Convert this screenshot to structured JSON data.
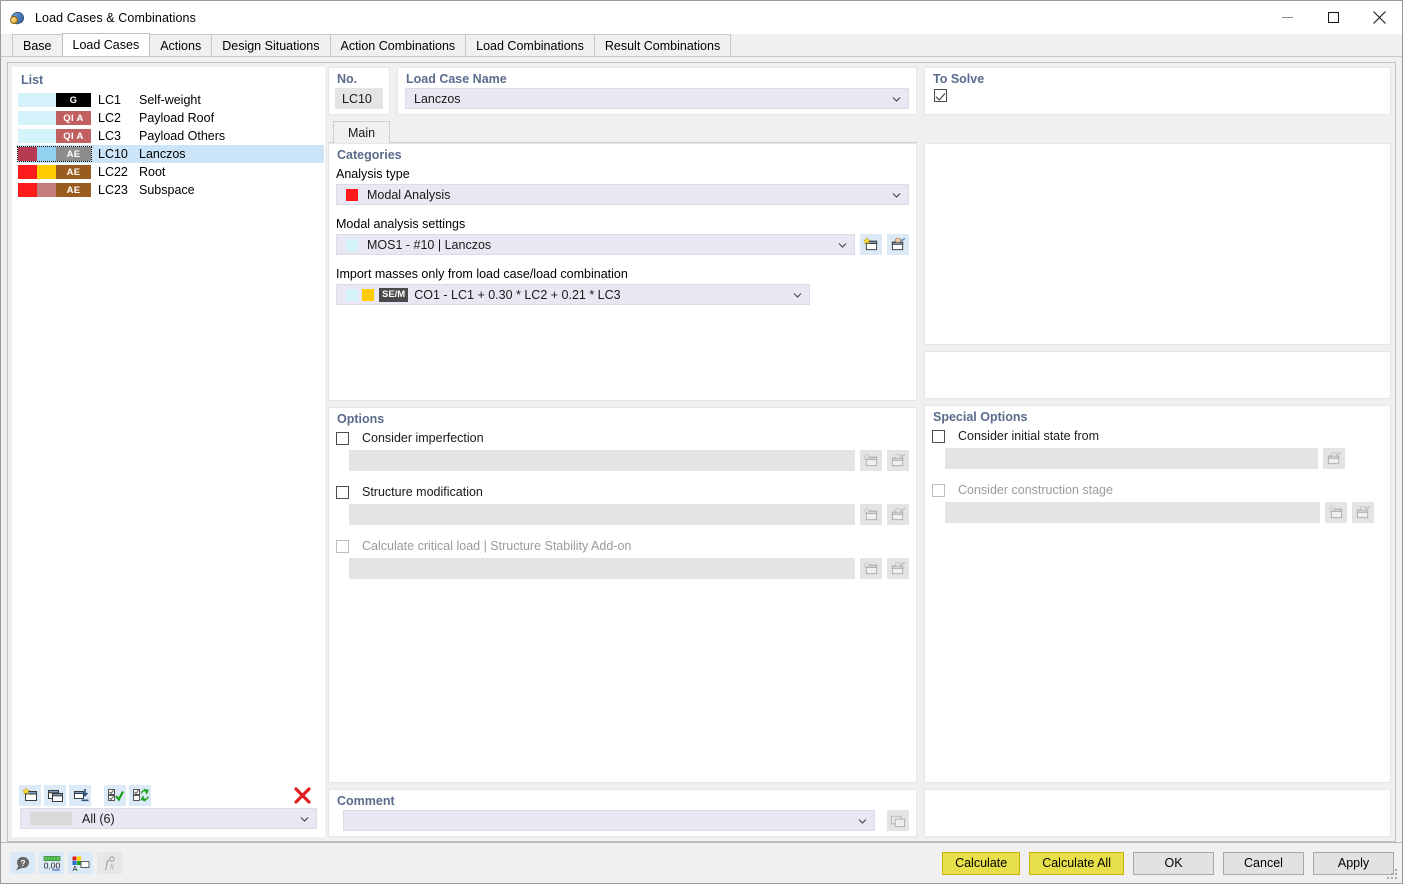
{
  "window": {
    "title": "Load Cases & Combinations",
    "icon": "app-icon",
    "minimize_label": "Minimize",
    "maximize_label": "Maximize",
    "close_label": "Close"
  },
  "tabs": [
    {
      "label": "Base",
      "active": false
    },
    {
      "label": "Load Cases",
      "active": true
    },
    {
      "label": "Actions",
      "active": false
    },
    {
      "label": "Design Situations",
      "active": false
    },
    {
      "label": "Action Combinations",
      "active": false
    },
    {
      "label": "Load Combinations",
      "active": false
    },
    {
      "label": "Result Combinations",
      "active": false
    }
  ],
  "list": {
    "title": "List",
    "rows": [
      {
        "id": "LC1",
        "name": "Self-weight",
        "badge": "G",
        "badge_color": "#000000",
        "color1": "#d4f3fb",
        "color2": "#d4f3fb",
        "selected": false
      },
      {
        "id": "LC2",
        "name": "Payload Roof",
        "badge": "QI A",
        "badge_color": "#c06060",
        "color1": "#d4f3fb",
        "color2": "#d4f3fb",
        "selected": false
      },
      {
        "id": "LC3",
        "name": "Payload Others",
        "badge": "QI A",
        "badge_color": "#c06060",
        "color1": "#d4f3fb",
        "color2": "#d4f3fb",
        "selected": false
      },
      {
        "id": "LC10",
        "name": "Lanczos",
        "badge": "AE",
        "badge_color": "#8c8c8c",
        "color1": "#b63a51",
        "color2": "#92d2f0",
        "selected": true
      },
      {
        "id": "LC22",
        "name": "Root",
        "badge": "AE",
        "badge_color": "#9a5b1e",
        "color1": "#fc1b1b",
        "color2": "#ffcc00",
        "selected": false
      },
      {
        "id": "LC23",
        "name": "Subspace",
        "badge": "AE",
        "badge_color": "#9a5b1e",
        "color1": "#fc1b1b",
        "color2": "#c47d7d",
        "selected": false
      }
    ],
    "toolbar": [
      {
        "name": "new-load-case-button",
        "title": "New"
      },
      {
        "name": "copy-load-case-button",
        "title": "Copy"
      },
      {
        "name": "import-load-case-button",
        "title": "Import"
      },
      {
        "name": "select-all-button",
        "title": "Select All"
      },
      {
        "name": "invert-selection-button",
        "title": "Invert Selection"
      },
      {
        "name": "delete-load-case-button",
        "title": "Delete"
      }
    ],
    "filter": {
      "label": "All (6)",
      "swatch": "#d9d9d9"
    }
  },
  "form": {
    "no": {
      "label": "No.",
      "value": "LC10"
    },
    "name": {
      "label": "Load Case Name",
      "value": "Lanczos"
    },
    "to_solve": {
      "label": "To Solve",
      "checked": true
    },
    "inner_tabs": [
      {
        "label": "Main",
        "active": true
      }
    ],
    "categories": {
      "title": "Categories",
      "analysis_type": {
        "label": "Analysis type",
        "value": "Modal Analysis",
        "swatch": "#ff1a1a"
      },
      "modal_settings": {
        "label": "Modal analysis settings",
        "value": "MOS1 - #10 | Lanczos",
        "swatch": "#d4f3fb",
        "buttons": [
          {
            "name": "new-modal-settings-button",
            "icon": "new-window-icon"
          },
          {
            "name": "edit-modal-settings-button",
            "icon": "edit-window-icon"
          }
        ]
      },
      "import_masses": {
        "label": "Import masses only from load case/load combination",
        "value": "CO1 - LC1 + 0.30 * LC2 + 0.21 * LC3",
        "badge": "SE/M",
        "badge_color": "#4a4a4a",
        "swatch1": "#d4f3fb",
        "swatch2": "#ffcc00"
      }
    },
    "options": {
      "title": "Options",
      "items": [
        {
          "label": "Consider imperfection",
          "checked": false,
          "disabled": false,
          "buttons": [
            {
              "name": "new-imperfection-button",
              "icon": "new-window-icon"
            },
            {
              "name": "edit-imperfection-button",
              "icon": "edit-window-icon"
            }
          ]
        },
        {
          "label": "Structure modification",
          "checked": false,
          "disabled": false,
          "buttons": [
            {
              "name": "new-structure-modification-button",
              "icon": "new-window-icon"
            },
            {
              "name": "edit-structure-modification-button",
              "icon": "edit-window-icon"
            }
          ]
        },
        {
          "label": "Calculate critical load | Structure Stability Add-on",
          "checked": false,
          "disabled": true,
          "buttons": [
            {
              "name": "new-critical-load-button",
              "icon": "new-window-icon"
            },
            {
              "name": "edit-critical-load-button",
              "icon": "edit-window-icon"
            }
          ]
        }
      ]
    },
    "special_options": {
      "title": "Special Options",
      "items": [
        {
          "label": "Consider initial state from",
          "checked": false,
          "disabled": false,
          "buttons": [
            {
              "name": "edit-initial-state-button",
              "icon": "edit-window-icon"
            }
          ]
        },
        {
          "label": "Consider construction stage",
          "checked": false,
          "disabled": true,
          "buttons": [
            {
              "name": "new-construction-stage-button",
              "icon": "new-window-icon"
            },
            {
              "name": "edit-construction-stage-button",
              "icon": "edit-window-icon"
            }
          ]
        }
      ]
    },
    "comment": {
      "title": "Comment",
      "value": "",
      "placeholder": "",
      "button": {
        "name": "comment-library-button",
        "icon": "copy-icon"
      }
    }
  },
  "footer": {
    "icons": [
      {
        "name": "help-button",
        "icon": "help-icon",
        "disabled": false
      },
      {
        "name": "number-format-button",
        "icon": "number-format-icon",
        "label": "0,00",
        "disabled": false
      },
      {
        "name": "display-properties-button",
        "icon": "display-properties-icon",
        "disabled": false
      },
      {
        "name": "formula-button",
        "icon": "formula-icon",
        "label": "f",
        "disabled": true
      }
    ],
    "buttons": [
      {
        "label": "Calculate",
        "name": "calculate-button",
        "style": "yellow"
      },
      {
        "label": "Calculate All",
        "name": "calculate-all-button",
        "style": "yellow"
      },
      {
        "label": "OK",
        "name": "ok-button",
        "style": "default"
      },
      {
        "label": "Cancel",
        "name": "cancel-button",
        "style": "default"
      },
      {
        "label": "Apply",
        "name": "apply-button",
        "style": "default"
      }
    ]
  },
  "colors": {
    "accent_heading": "#5a6b8c",
    "field_bg": "#e8e8f2",
    "disabled_bg": "#e4e4e4",
    "selection": "#cce4f7",
    "yellow_button": "#e8e04a"
  }
}
